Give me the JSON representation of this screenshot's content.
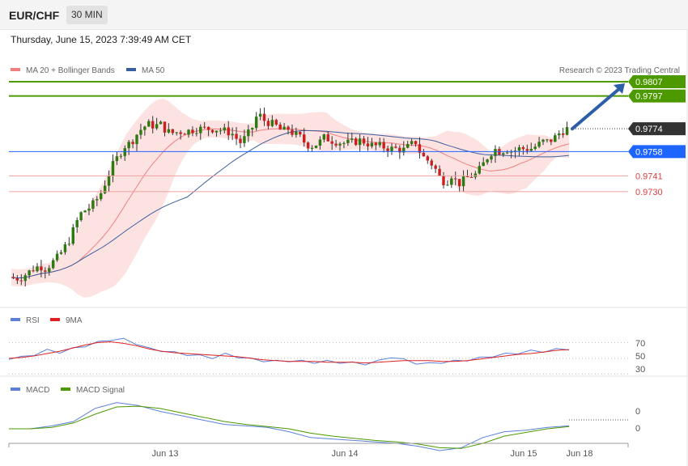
{
  "header": {
    "symbol": "EUR/CHF",
    "timeframe": "30 MIN"
  },
  "timestamp": "Thursday, June 15, 2023 7:39:49 AM CET",
  "credit": "Research © 2023 Trading Central",
  "colors": {
    "bands": "#f4a4a4",
    "ma20": "#f08080",
    "ma50": "#3a5f9f",
    "target": "#4c9a00",
    "pivot": "#1e64ff",
    "support": "#e04040",
    "current": "#333333",
    "up": "#2d7a10",
    "down": "#cc2020",
    "rsi": "#5b7fd8",
    "rsi_ma": "#e02020",
    "macd": "#5b7fd8",
    "macd_signal": "#4c9a00",
    "arrow": "#2d5fa8"
  },
  "chart_data": [
    {
      "type": "candlestick",
      "title": "EUR/CHF",
      "legend": [
        {
          "name": "MA 20 + Bollinger Bands",
          "color": "#f08080"
        },
        {
          "name": "MA 50",
          "color": "#3a5f9f"
        }
      ],
      "legend_position": "top-left",
      "x_ticks": [
        "Jun 13",
        "Jun 14",
        "Jun 15",
        "Jun 18"
      ],
      "ylim": [
        0.965,
        0.982
      ],
      "close_path": [
        0.967,
        0.9669,
        0.967,
        0.9673,
        0.9676,
        0.9678,
        0.9676,
        0.968,
        0.9684,
        0.969,
        0.9697,
        0.9708,
        0.9716,
        0.9718,
        0.9722,
        0.9728,
        0.9738,
        0.9748,
        0.9755,
        0.9762,
        0.9764,
        0.977,
        0.9775,
        0.9777,
        0.9776,
        0.9777,
        0.9772,
        0.9771,
        0.9772,
        0.9772,
        0.9773,
        0.9774,
        0.9774,
        0.9774,
        0.9774,
        0.9773,
        0.9772,
        0.977,
        0.9764,
        0.9768,
        0.9774,
        0.9785,
        0.978,
        0.9778,
        0.9776,
        0.9772,
        0.9774,
        0.977,
        0.9768,
        0.9763,
        0.9762,
        0.9764,
        0.9768,
        0.9766,
        0.9765,
        0.9764,
        0.9764,
        0.9765,
        0.9766,
        0.9764,
        0.9762,
        0.9762,
        0.9761,
        0.976,
        0.976,
        0.9759,
        0.9762,
        0.9765,
        0.9755,
        0.9752,
        0.9748,
        0.974,
        0.9736,
        0.9742,
        0.9735,
        0.9738,
        0.9741,
        0.9742,
        0.9748,
        0.9755,
        0.976,
        0.9758,
        0.976,
        0.9758,
        0.976,
        0.976,
        0.976,
        0.9762,
        0.9765,
        0.9765,
        0.9768,
        0.9772,
        0.9774
      ],
      "levels": [
        {
          "label": "0.9807",
          "value": 0.9807,
          "kind": "target"
        },
        {
          "label": "0.9797",
          "value": 0.9797,
          "kind": "target"
        },
        {
          "label": "0.9774",
          "value": 0.9774,
          "kind": "current"
        },
        {
          "label": "0.9758",
          "value": 0.9758,
          "kind": "pivot"
        },
        {
          "label": "0.9741",
          "value": 0.9741,
          "kind": "support"
        },
        {
          "label": "0.9730",
          "value": 0.973,
          "kind": "support"
        }
      ]
    },
    {
      "type": "line",
      "panel": "RSI",
      "series": [
        {
          "name": "RSI"
        },
        {
          "name": "9MA"
        }
      ],
      "ylim": [
        20,
        90
      ],
      "ticks": [
        "70",
        "50",
        "30"
      ],
      "rsi": [
        50,
        51,
        55,
        60,
        58,
        62,
        66,
        70,
        74,
        74,
        69,
        62,
        60,
        57,
        55,
        53,
        51,
        55,
        52,
        49,
        47,
        46,
        47,
        46,
        45,
        46,
        45,
        44,
        43,
        46,
        52,
        48,
        44,
        43,
        45,
        46,
        48,
        50,
        53,
        55,
        57,
        59,
        59,
        61,
        62
      ],
      "rsi_ma": [
        50,
        51,
        53,
        56,
        59,
        63,
        67,
        70,
        71,
        69,
        66,
        62,
        59,
        57,
        56,
        55,
        54,
        53,
        52,
        50,
        48,
        47,
        46,
        46,
        46,
        45,
        45,
        45,
        44,
        45,
        46,
        47,
        47,
        47,
        46,
        46,
        47,
        49,
        51,
        53,
        55,
        56,
        58,
        60,
        61
      ]
    },
    {
      "type": "line",
      "panel": "MACD",
      "series": [
        {
          "name": "MACD"
        },
        {
          "name": "MACD Signal"
        }
      ],
      "ticks": [
        "0",
        "0"
      ],
      "macd": [
        0,
        0,
        0.4,
        1.0,
        2.8,
        3.6,
        3.2,
        2.4,
        1.8,
        1.2,
        0.6,
        0.4,
        0.2,
        -0.4,
        -1.2,
        -1.4,
        -1.6,
        -1.8,
        -2.0,
        -2.4,
        -3.0,
        -2.6,
        -1.2,
        -0.4,
        -0.2,
        0.2,
        0.4
      ],
      "macd_signal": [
        0,
        0,
        0.2,
        0.8,
        2.0,
        3.0,
        3.1,
        2.8,
        2.2,
        1.6,
        1.0,
        0.6,
        0.3,
        0,
        -0.6,
        -1.0,
        -1.3,
        -1.6,
        -1.8,
        -2.1,
        -2.6,
        -2.7,
        -2.0,
        -1.0,
        -0.5,
        0,
        0.3
      ]
    }
  ]
}
